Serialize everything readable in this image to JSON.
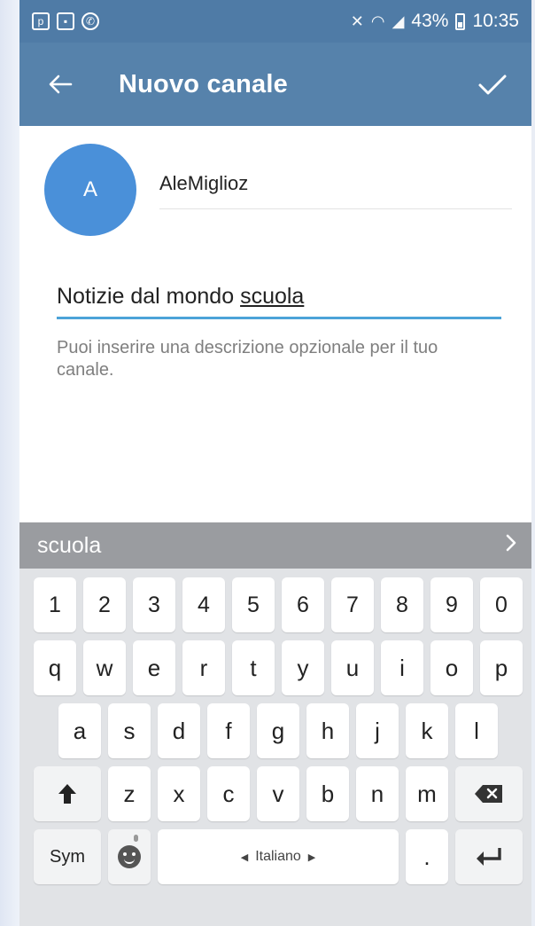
{
  "status_bar": {
    "left_icons": [
      "p-icon",
      "gallery-icon",
      "whatsapp-icon"
    ],
    "battery_percent": "43%",
    "time": "10:35"
  },
  "app_bar": {
    "title": "Nuovo canale"
  },
  "profile": {
    "avatar_initial": "A",
    "name_value": "AleMiglioz"
  },
  "description": {
    "value_prefix": "Notizie dal mondo ",
    "value_underlined": "scuola",
    "hint": "Puoi inserire una descrizione opzionale per il tuo canale."
  },
  "suggestion_bar": {
    "suggestion": "scuola",
    "expand_symbol": "›"
  },
  "keyboard": {
    "row_numbers": [
      "1",
      "2",
      "3",
      "4",
      "5",
      "6",
      "7",
      "8",
      "9",
      "0"
    ],
    "row_top": [
      "q",
      "w",
      "e",
      "r",
      "t",
      "y",
      "u",
      "i",
      "o",
      "p"
    ],
    "row_middle": [
      "a",
      "s",
      "d",
      "f",
      "g",
      "h",
      "j",
      "k",
      "l"
    ],
    "row_bottom": [
      "z",
      "x",
      "c",
      "v",
      "b",
      "n",
      "m"
    ],
    "sym_label": "Sym",
    "space_label": "Italiano",
    "period_label": "."
  }
}
